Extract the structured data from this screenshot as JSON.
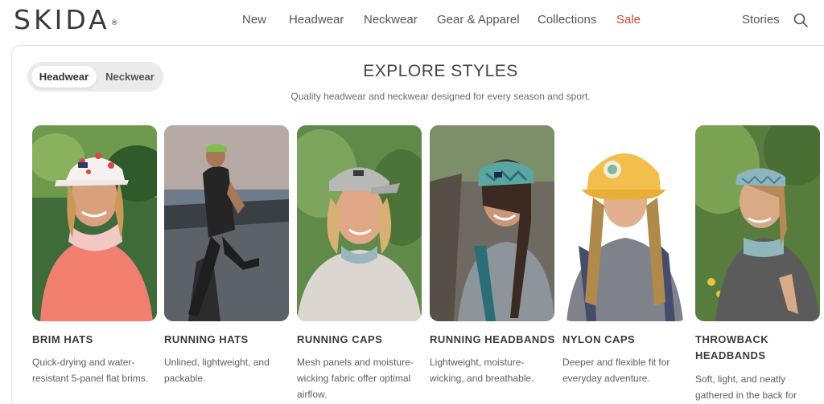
{
  "brand": {
    "name": "SKIDA",
    "mark": "®"
  },
  "nav": {
    "items": [
      "New",
      "Headwear",
      "Neckwear",
      "Gear & Apparel",
      "Collections",
      "Sale"
    ],
    "stories": "Stories"
  },
  "colors": {
    "sale": "#e03c31",
    "text": "#3d3d3d",
    "toggle_bg": "#ebebeb"
  },
  "toggle": {
    "active": "Headwear",
    "inactive": "Neckwear"
  },
  "section": {
    "title": "EXPLORE STYLES",
    "subtitle": "Quality headwear and neckwear designed for every season and sport."
  },
  "products": [
    {
      "name": "BRIM HATS",
      "desc": "Quick-drying and water-resistant 5-panel flat brims."
    },
    {
      "name": "RUNNING HATS",
      "desc": "Unlined, lightweight, and packable."
    },
    {
      "name": "RUNNING CAPS",
      "desc": "Mesh panels and moisture-wicking fabric offer optimal airflow."
    },
    {
      "name": "RUNNING HEADBANDS",
      "desc": "Lightweight, moisture-wicking, and breathable."
    },
    {
      "name": "NYLON CAPS",
      "desc": "Deeper and flexible fit for everyday adventure."
    },
    {
      "name": "THROWBACK HEADBANDS",
      "desc": "Soft, light, and neatly gathered in the back for"
    }
  ],
  "icons": {
    "search": "search-icon"
  }
}
